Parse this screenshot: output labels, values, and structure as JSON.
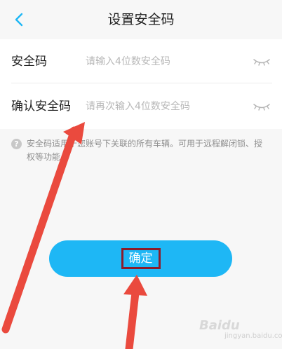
{
  "header": {
    "title": "设置安全码",
    "back_icon": "chevron-left-icon"
  },
  "form": {
    "code_label": "安全码",
    "code_placeholder": "请输入4位数安全码",
    "confirm_label": "确认安全码",
    "confirm_placeholder": "请再次输入4位数安全码",
    "visibility_icon": "eye-closed-icon"
  },
  "hint": {
    "icon": "question-circle-icon",
    "text": "安全码适用于您账号下关联的所有车辆。可用于远程解闭锁、授权等功能。"
  },
  "confirm_button": {
    "label": "确定"
  },
  "colors": {
    "accent": "#1eb7f5",
    "annotation_arrow": "#ea4a3e",
    "annotation_box": "#8b1c2b"
  },
  "watermark": {
    "brand": "Baidu",
    "sub": "jingyan.baidu.com"
  }
}
